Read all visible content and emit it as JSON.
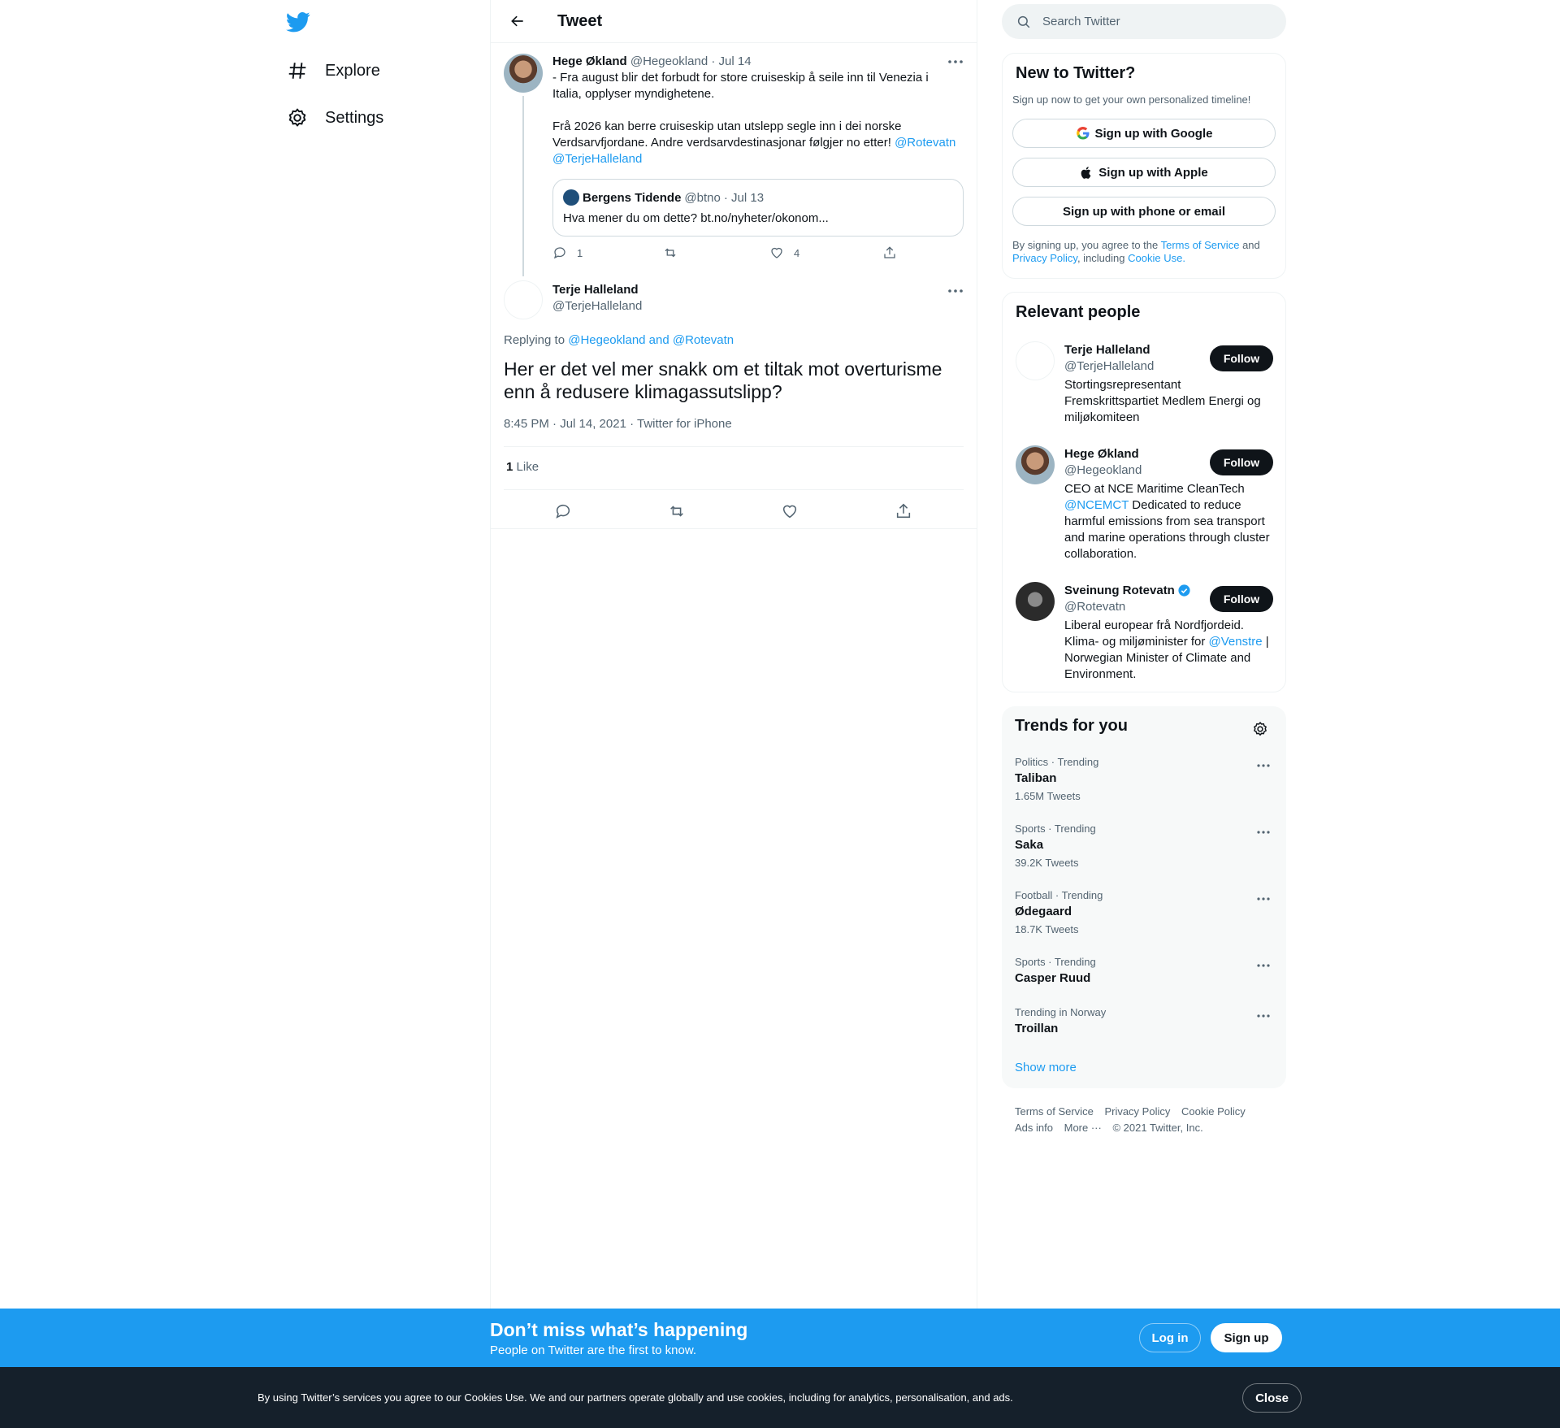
{
  "nav": {
    "items": [
      {
        "label": "Explore",
        "icon": "hashtag-icon"
      },
      {
        "label": "Settings",
        "icon": "gear-icon"
      }
    ]
  },
  "header": {
    "title": "Tweet"
  },
  "parent_tweet": {
    "name": "Hege Økland",
    "handle": "@Hegeokland",
    "date": "· Jul 14",
    "text_p1": "- Fra august blir det forbudt for store cruiseskip å seile inn til Venezia i Italia, opplyser myndighetene.",
    "text_p2": "Frå 2026 kan berre cruiseskip utan utslepp segle inn i dei norske Verdsarvfjordane. Andre verdsarvdestinasjonar følgjer no etter!",
    "mention1": "@Rotevatn",
    "mention2": "@TerjeHalleland",
    "quote": {
      "name": "Bergens Tidende",
      "handle": "@btno",
      "date": "· Jul 13",
      "text": "Hva mener du om dette? bt.no/nyheter/okonom..."
    },
    "reply_count": "1",
    "like_count": "4"
  },
  "main_tweet": {
    "name": "Terje Halleland",
    "handle": "@TerjeHalleland",
    "replying_to_label": "Replying to",
    "replying_to": "@Hegeokland and @Rotevatn",
    "text": "Her er det vel mer snakk om et tiltak mot overturisme enn å redusere klimagassutslipp?",
    "timestamp": "8:45 PM · Jul 14, 2021 · Twitter for iPhone",
    "likes_count": "1",
    "likes_label": "Like"
  },
  "search": {
    "placeholder": "Search Twitter"
  },
  "new_to_twitter": {
    "title": "New to Twitter?",
    "subtitle": "Sign up now to get your own personalized timeline!",
    "google": "Sign up with Google",
    "apple": "Sign up with Apple",
    "phone": "Sign up with phone or email",
    "legal_1": "By signing up, you agree to the",
    "terms": "Terms of Service",
    "legal_and": "and",
    "privacy": "Privacy Policy",
    "legal_including": ", including",
    "cookie": "Cookie Use."
  },
  "relevant_people": {
    "title": "Relevant people",
    "follow_label": "Follow",
    "people": [
      {
        "name": "Terje Halleland",
        "handle": "@TerjeHalleland",
        "bio": "Stortingsrepresentant Fremskrittspartiet Medlem Energi og miljøkomiteen"
      },
      {
        "name": "Hege Økland",
        "handle": "@Hegeokland",
        "bio_mention": "@NCEMCT",
        "bio_pre": "CEO at NCE Maritime CleanTech",
        "bio_post": "Dedicated to reduce harmful emissions from sea transport and marine operations through cluster collaboration."
      },
      {
        "name": "Sveinung Rotevatn",
        "handle": "@Rotevatn",
        "bio_pre": "Liberal europear frå Nordfjordeid. Klima- og miljøminister for",
        "bio_mention": "@Venstre",
        "bio_post": "| Norwegian Minister of Climate and Environment."
      }
    ]
  },
  "trends": {
    "title": "Trends for you",
    "items": [
      {
        "meta": "Politics · Trending",
        "name": "Taliban",
        "count": "1.65M Tweets"
      },
      {
        "meta": "Sports · Trending",
        "name": "Saka",
        "count": "39.2K Tweets"
      },
      {
        "meta": "Football · Trending",
        "name": "Ødegaard",
        "count": "18.7K Tweets"
      },
      {
        "meta": "Sports · Trending",
        "name": "Casper Ruud",
        "count": ""
      },
      {
        "meta": "Trending in Norway",
        "name": "Troillan",
        "count": ""
      }
    ],
    "show_more": "Show more"
  },
  "footer": {
    "terms": "Terms of Service",
    "privacy": "Privacy Policy",
    "cookie": "Cookie Policy",
    "ads": "Ads info",
    "more": "More ···",
    "copyright": "© 2021 Twitter, Inc."
  },
  "banner": {
    "title": "Don’t miss what’s happening",
    "subtitle": "People on Twitter are the first to know.",
    "login": "Log in",
    "signup": "Sign up"
  },
  "cookie_bar": {
    "text": "By using Twitter’s services you agree to our Cookies Use. We and our partners operate globally and use cookies, including for analytics, personalisation, and ads.",
    "close": "Close"
  },
  "colors": {
    "accent": "#1d9bf0",
    "text": "#0f1419",
    "muted": "#536471",
    "cookie_bg": "#15202b"
  }
}
